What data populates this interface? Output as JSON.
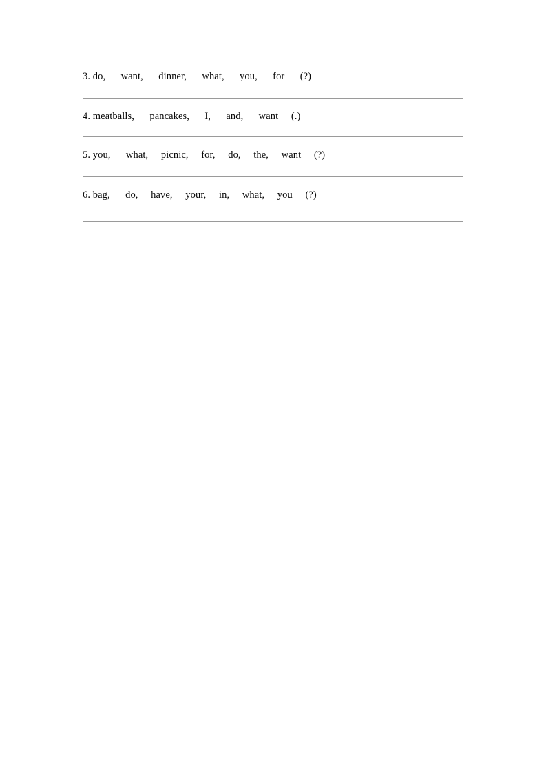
{
  "document": {
    "type": "worksheet",
    "page_background": "#ffffff",
    "text_color": "#0a0a0a",
    "rule_color": "#9a9a9a"
  },
  "exercises": [
    {
      "number": "3.",
      "words": [
        "do,",
        "want,",
        "dinner,",
        "what,",
        "you,",
        "for"
      ],
      "punctuation": "(?)",
      "line": "3. do,      want,      dinner,      what,      you,      for      (?)",
      "answer_line": true
    },
    {
      "number": "4.",
      "words": [
        "meatballs,",
        "pancakes,",
        "I,",
        "and,",
        "want"
      ],
      "punctuation": "(.)",
      "line": "4. meatballs,      pancakes,      I,      and,      want     (.)",
      "answer_line": true
    },
    {
      "number": "5.",
      "words": [
        "you,",
        "what,",
        "picnic,",
        "for,",
        "do,",
        "the,",
        "want"
      ],
      "punctuation": "(?)",
      "line": "5. you,      what,     picnic,     for,     do,     the,     want     (?)",
      "answer_line": true
    },
    {
      "number": "6.",
      "words": [
        "bag,",
        "do,",
        "have,",
        "your,",
        "in,",
        "what,",
        "you"
      ],
      "punctuation": "(?)",
      "line": "6. bag,      do,     have,     your,     in,     what,     you     (?)",
      "answer_line": true
    }
  ]
}
